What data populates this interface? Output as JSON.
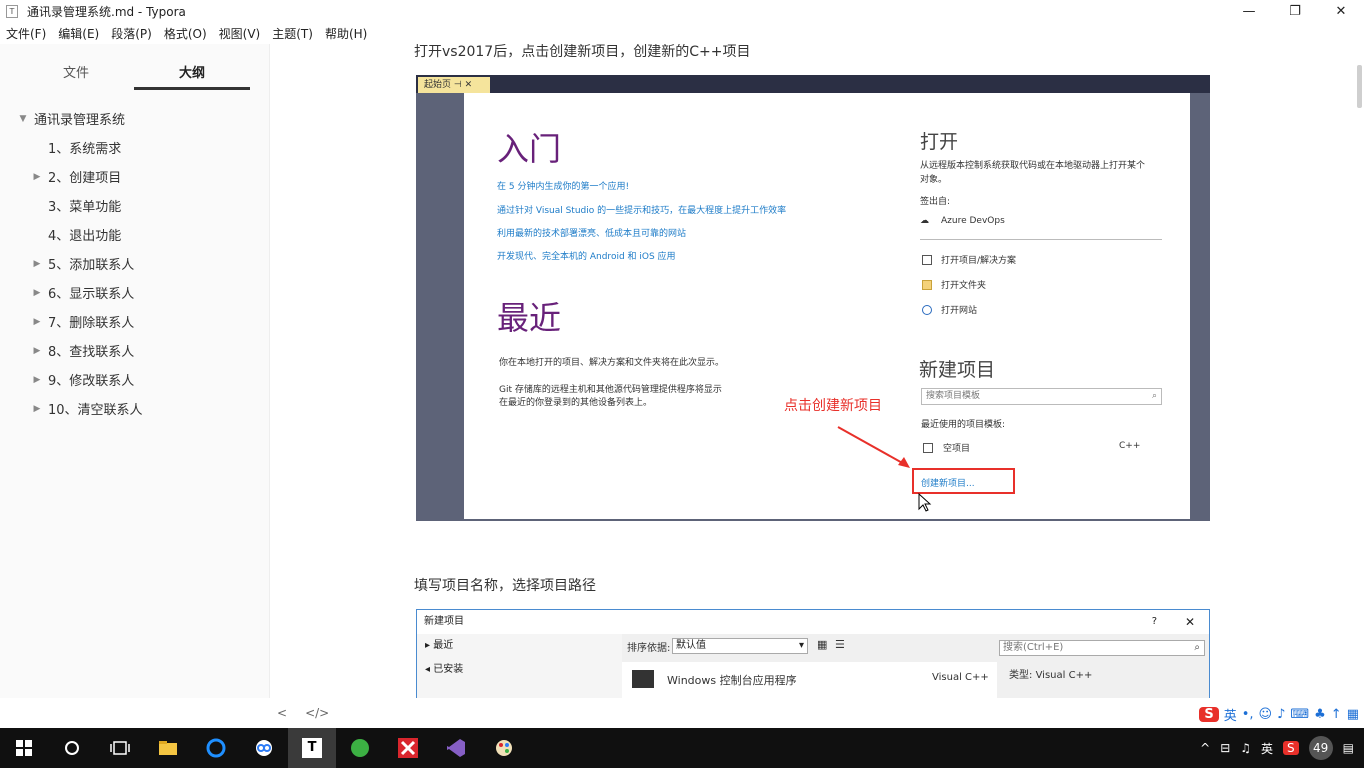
{
  "window": {
    "title": "通讯录管理系统.md - Typora",
    "app_icon": "T"
  },
  "controls": {
    "minimize": "—",
    "maximize": "❐",
    "close": "✕"
  },
  "menu": [
    "文件(F)",
    "编辑(E)",
    "段落(P)",
    "格式(O)",
    "视图(V)",
    "主题(T)",
    "帮助(H)"
  ],
  "sidebar": {
    "tabs": [
      {
        "label": "文件",
        "active": false
      },
      {
        "label": "大纲",
        "active": true
      }
    ],
    "outline": [
      {
        "label": "通讯录管理系统",
        "level": 0,
        "caret": "expanded"
      },
      {
        "label": "1、系统需求",
        "level": 1,
        "caret": "none"
      },
      {
        "label": "2、创建项目",
        "level": 1,
        "caret": "collapsed"
      },
      {
        "label": "3、菜单功能",
        "level": 1,
        "caret": "none"
      },
      {
        "label": "4、退出功能",
        "level": 1,
        "caret": "none"
      },
      {
        "label": "5、添加联系人",
        "level": 1,
        "caret": "collapsed"
      },
      {
        "label": "6、显示联系人",
        "level": 1,
        "caret": "collapsed"
      },
      {
        "label": "7、删除联系人",
        "level": 1,
        "caret": "collapsed"
      },
      {
        "label": "8、查找联系人",
        "level": 1,
        "caret": "collapsed"
      },
      {
        "label": "9、修改联系人",
        "level": 1,
        "caret": "collapsed"
      },
      {
        "label": "10、清空联系人",
        "level": 1,
        "caret": "collapsed"
      }
    ]
  },
  "content": {
    "para1": "打开vs2017后，点击创建新项目，创建新的C++项目",
    "para2": "填写项目名称，选择项目路径"
  },
  "vs_start": {
    "tab_label": "起始页",
    "tab_pin": "⊣",
    "tab_close": "✕",
    "intro_title": "入门",
    "links": [
      "在 5 分钟内生成你的第一个应用!",
      "通过针对 Visual Studio 的一些提示和技巧，在最大程度上提升工作效率",
      "利用最新的技术部署漂亮、低成本且可靠的网站",
      "开发现代、完全本机的 Android 和 iOS 应用"
    ],
    "recent_title": "最近",
    "recent_text1": "你在本地打开的项目、解决方案和文件夹将在此次显示。",
    "recent_text2a": "Git 存储库的远程主机和其他源代码管理提供程序将显示",
    "recent_text2b": "在最近的你登录到的其他设备列表上。",
    "open_title": "打开",
    "open_desc1": "从远程版本控制系统获取代码或在本地驱动器上打开某个",
    "open_desc2": "对象。",
    "checkout_label": "签出自:",
    "azure": "Azure DevOps",
    "open_items": [
      "打开项目/解决方案",
      "打开文件夹",
      "打开网站"
    ],
    "new_title": "新建项目",
    "search_placeholder": "搜索项目模板",
    "recent_templates_label": "最近使用的项目模板:",
    "empty_project": "空项目",
    "cpp": "C++",
    "create_new": "创建新项目...",
    "annotation": "点击创建新项目"
  },
  "vs_new": {
    "title": "新建项目",
    "help": "?",
    "close": "✕",
    "tree": [
      "最近",
      "已安装"
    ],
    "tree_arrows": [
      "▸",
      "◂"
    ],
    "sort_label": "排序依据:",
    "sort_value": "默认值",
    "search_placeholder": "搜索(Ctrl+E)",
    "template_name": "Windows 控制台应用程序",
    "template_lang": "Visual C++",
    "type_label": "类型:",
    "type_value": "Visual C++"
  },
  "statusbar": {
    "back": "<",
    "source": "</>"
  },
  "ime": {
    "logo": "S",
    "lang": "英",
    "punct": "•,"
  },
  "tray": {
    "lang": "英",
    "count": "49"
  },
  "colors": {
    "accent": "#68217a",
    "link": "#1e7cc8",
    "highlight": "#e8302a"
  }
}
